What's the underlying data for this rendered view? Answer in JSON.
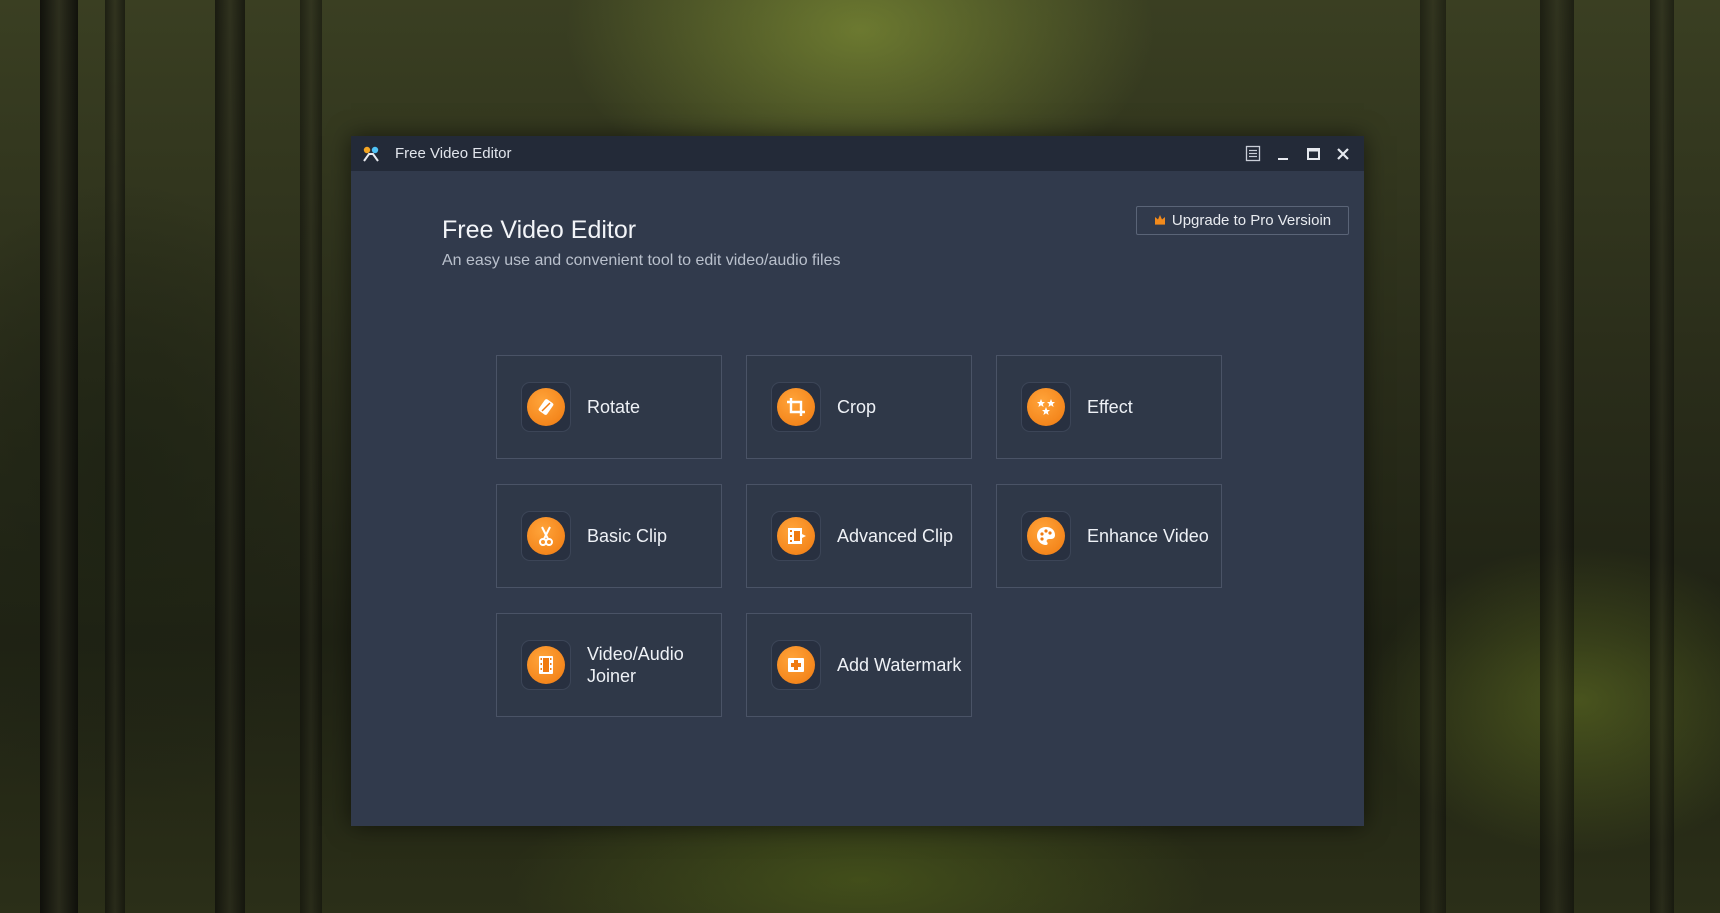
{
  "window": {
    "title": "Free Video Editor",
    "controls": [
      "menu-icon",
      "minimize-icon",
      "maximize-icon",
      "close-icon"
    ]
  },
  "header": {
    "title": "Free Video Editor",
    "subtitle": "An easy use and convenient tool to edit video/audio files"
  },
  "upgrade": {
    "label": "Upgrade to Pro Versioin",
    "icon": "crown-icon"
  },
  "tools": [
    {
      "label": "Rotate",
      "icon": "rotate-icon"
    },
    {
      "label": "Crop",
      "icon": "crop-icon"
    },
    {
      "label": "Effect",
      "icon": "effect-icon"
    },
    {
      "label": "Basic Clip",
      "icon": "scissors-icon"
    },
    {
      "label": "Advanced Clip",
      "icon": "film-clip-icon"
    },
    {
      "label": "Enhance Video",
      "icon": "palette-icon"
    },
    {
      "label": "Video/Audio Joiner",
      "icon": "joiner-icon"
    },
    {
      "label": "Add Watermark",
      "icon": "watermark-icon"
    }
  ],
  "colors": {
    "accent": "#f28a1c",
    "window_bg": "#313a4c",
    "titlebar_bg": "#232a38",
    "tile_border": "#4a5366"
  }
}
